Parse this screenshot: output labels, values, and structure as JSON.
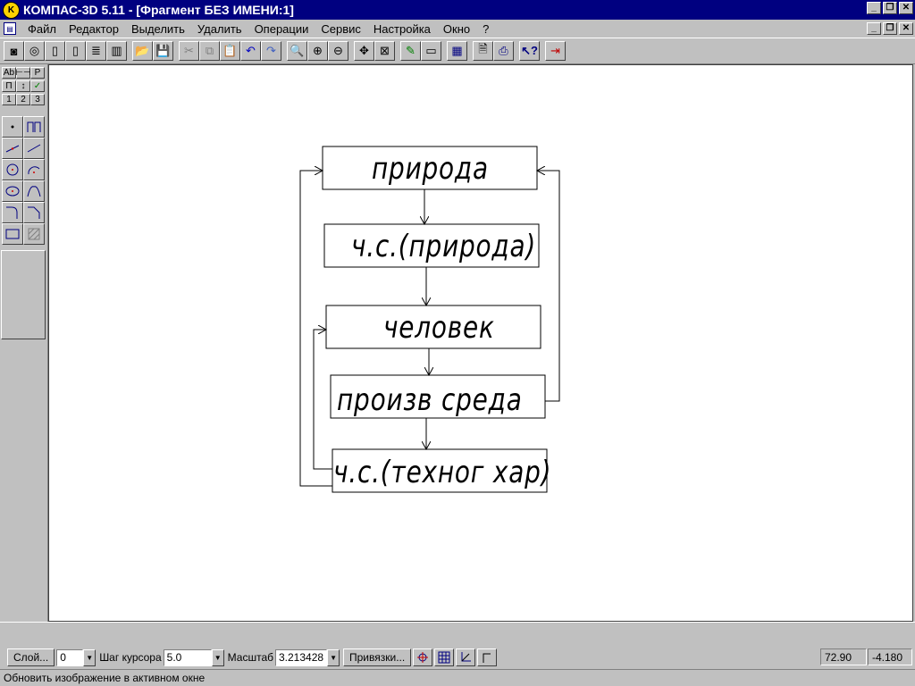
{
  "window": {
    "title": "КОМПАС-3D 5.11 - [Фрагмент БЕЗ ИМЕНИ:1]",
    "controls": [
      "minimize-icon",
      "restore-icon",
      "close-icon"
    ]
  },
  "menu": {
    "items": [
      {
        "label": "Файл"
      },
      {
        "label": "Редактор"
      },
      {
        "label": "Выделить"
      },
      {
        "label": "Удалить"
      },
      {
        "label": "Операции"
      },
      {
        "label": "Сервис"
      },
      {
        "label": "Настройка"
      },
      {
        "label": "Окно"
      },
      {
        "label": "?"
      }
    ]
  },
  "toolbar": {
    "icons": [
      "new-3d-icon",
      "new-3d-assembly-icon",
      "new-sheet-icon",
      "new-fragment-icon",
      "new-text-icon",
      "new-spec-icon",
      "open-icon",
      "save-icon",
      "cut-icon",
      "copy-icon",
      "paste-icon",
      "undo-icon",
      "redo-icon",
      "zoom-window-icon",
      "zoom-in-icon",
      "zoom-out-icon",
      "pan-icon",
      "zoom-all-icon",
      "edit-icon",
      "view-manager-icon",
      "calc-icon",
      "preview-icon",
      "print-icon",
      "help-cursor-icon",
      "exit-icon"
    ]
  },
  "palette": {
    "row1": [
      "Ab",
      "⊢⊣",
      "P"
    ],
    "row2": [
      "П",
      "↕",
      "✓"
    ],
    "row3": [
      "1",
      "2",
      "3"
    ],
    "tools": [
      "point-icon",
      "auxiliary-line-icon",
      "segment-icon",
      "parallel-segment-icon",
      "circle-icon",
      "arc-icon",
      "ellipse-icon",
      "spline-icon",
      "fillet-icon",
      "chamfer-icon",
      "rectangle-icon",
      "hatch-icon"
    ]
  },
  "diagram": {
    "boxes": [
      {
        "label": "природа"
      },
      {
        "label": "ч.с.(природа)"
      },
      {
        "label": "человек"
      },
      {
        "label": "произв среда"
      },
      {
        "label": "ч.с.(техног хар)"
      }
    ]
  },
  "status": {
    "layer_button": "Слой...",
    "layer_value": "0",
    "step_label": "Шаг курсора",
    "step_value": "5.0",
    "scale_label": "Масштаб",
    "scale_value": "3.213428",
    "snap_button": "Привязки...",
    "mode_icons": [
      "ortho-snap-icon",
      "grid-icon",
      "local-cs-icon",
      "ortho-mode-icon"
    ],
    "coord_x": "72.90",
    "coord_y": "-4.180",
    "hint": "Обновить изображение в активном окне"
  }
}
